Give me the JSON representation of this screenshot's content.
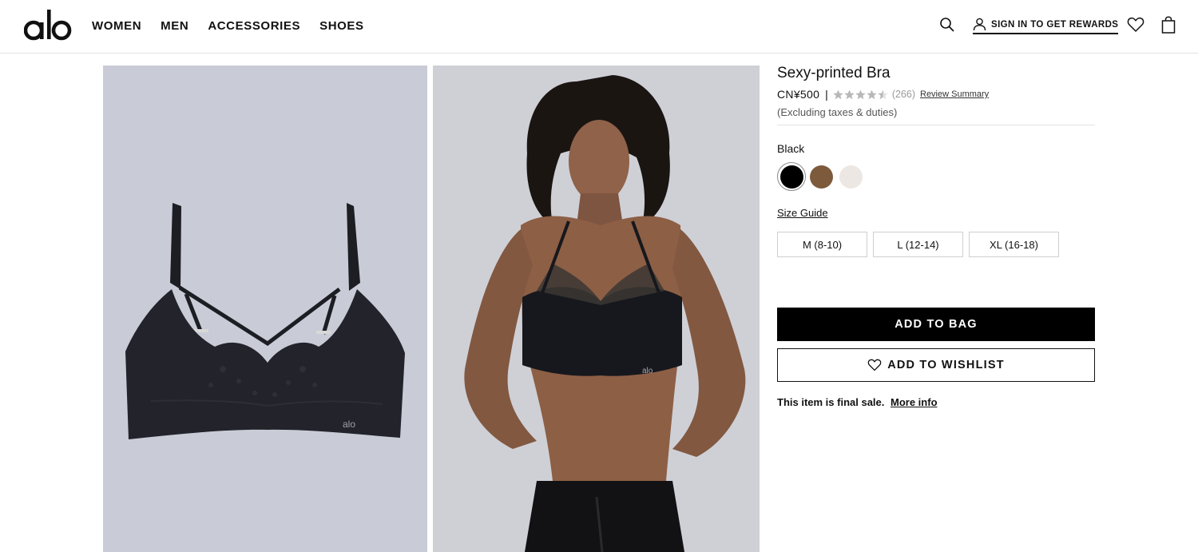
{
  "header": {
    "logo_text": "alo",
    "nav": [
      {
        "label": "WOMEN"
      },
      {
        "label": "MEN"
      },
      {
        "label": "ACCESSORIES"
      },
      {
        "label": "SHOES"
      }
    ],
    "icons": {
      "search": "search-icon",
      "account": "user-icon",
      "wishlist": "heart-icon",
      "bag": "shopping-bag-icon"
    },
    "signin_label": "SIGN IN TO GET REWARDS"
  },
  "gallery": {
    "images": [
      {
        "name": "bra-flat-lay-image",
        "logo_text": "alo"
      },
      {
        "name": "model-wearing-bra-image",
        "logo_text": "alo"
      }
    ]
  },
  "product": {
    "title": "Sexy-printed Bra",
    "price": "CN¥500",
    "separator": "|",
    "rating": 4.5,
    "rating_max": 5,
    "review_count": "(266)",
    "review_summary_label": "Review Summary",
    "tax_note": "(Excluding taxes & duties)",
    "selected_color": "Black",
    "colors": [
      {
        "name": "Black",
        "hex": "#000000",
        "selected": true
      },
      {
        "name": "Brown",
        "hex": "#7d5a3c",
        "selected": false
      },
      {
        "name": "Ivory",
        "hex": "#ece7e2",
        "selected": false
      }
    ],
    "size_guide_label": "Size Guide",
    "sizes": [
      {
        "label": "M (8-10)"
      },
      {
        "label": "L (12-14)"
      },
      {
        "label": "XL (16-18)"
      }
    ],
    "add_to_bag_label": "ADD TO BAG",
    "add_to_wishlist_label": "ADD TO WISHLIST",
    "final_sale_text": "This item is final sale.",
    "more_info_label": "More info",
    "star_color": "#b8b8b8"
  }
}
